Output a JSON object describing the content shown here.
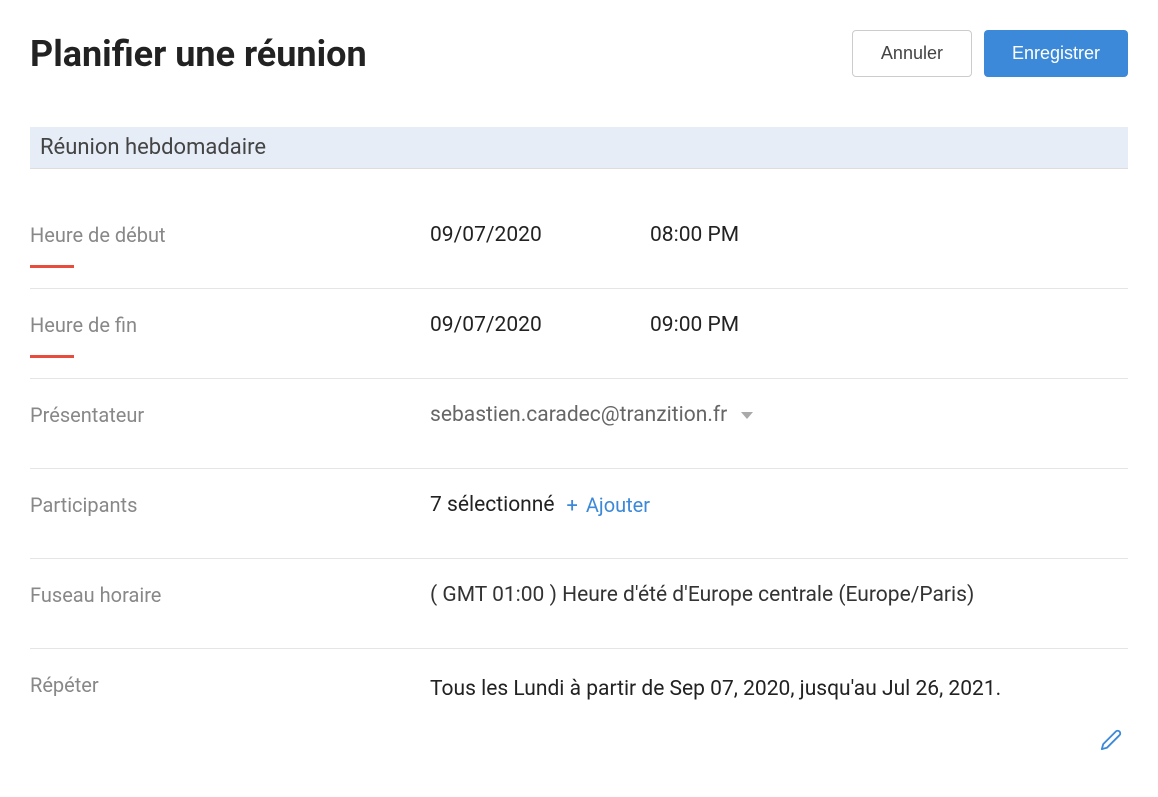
{
  "header": {
    "title": "Planifier une réunion",
    "cancel": "Annuler",
    "save": "Enregistrer"
  },
  "meeting": {
    "title": "Réunion hebdomadaire"
  },
  "form": {
    "start_label": "Heure de début",
    "start_date": "09/07/2020",
    "start_time": "08:00 PM",
    "end_label": "Heure de fin",
    "end_date": "09/07/2020",
    "end_time": "09:00 PM",
    "presenter_label": "Présentateur",
    "presenter_value": "sebastien.caradec@tranzition.fr",
    "participants_label": "Participants",
    "participants_count": "7 sélectionné",
    "participants_add": "Ajouter",
    "timezone_label": "Fuseau horaire",
    "timezone_value": "( GMT 01:00 ) Heure d'été d'Europe centrale (Europe/Paris)",
    "repeat_label": "Répéter",
    "repeat_value": "Tous les Lundi à partir de Sep 07, 2020, jusqu'au Jul 26, 2021."
  }
}
